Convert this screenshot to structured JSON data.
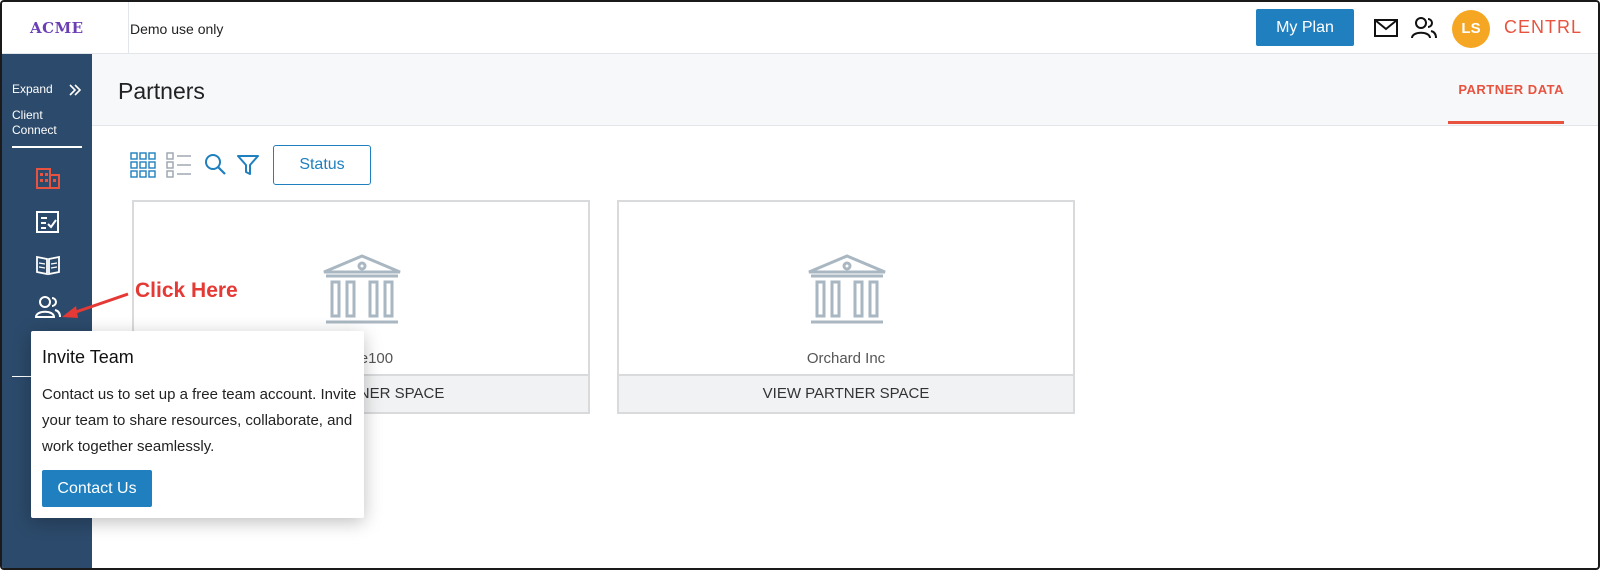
{
  "topbar": {
    "logo": "ACME",
    "demo_text": "Demo use only",
    "my_plan_label": "My Plan",
    "avatar_initials": "LS",
    "brand": "CENTRL"
  },
  "sidebar": {
    "expand_label": "Expand",
    "client_connect_label": "Client Connect"
  },
  "main": {
    "page_title": "Partners",
    "partner_data_tab": "PARTNER DATA",
    "status_filter_label": "Status"
  },
  "cards": [
    {
      "name": "Forge100",
      "action_label": "VIEW PARTNER SPACE"
    },
    {
      "name": "Orchard Inc",
      "action_label": "VIEW PARTNER SPACE"
    }
  ],
  "annotation": {
    "text": "Click Here"
  },
  "popover": {
    "title": "Invite Team",
    "body": "Contact us to set up a free team account. Invite your team to share resources, collaborate, and work together seamlessly.",
    "button_label": "Contact Us"
  },
  "colors": {
    "primary": "#1f7fbf",
    "sidebar": "#2c4a6b",
    "accent": "#e8533f",
    "avatar": "#f5a623",
    "annotation": "#e53935"
  },
  "icons": {
    "grid_view": "grid-view-icon",
    "list_view": "list-view-icon",
    "search": "search-icon",
    "filter": "filter-icon",
    "mail": "mail-icon",
    "people": "people-icon",
    "building": "building-icon",
    "checklist": "checklist-icon",
    "book": "book-icon",
    "team": "team-icon",
    "bank": "bank-icon"
  }
}
